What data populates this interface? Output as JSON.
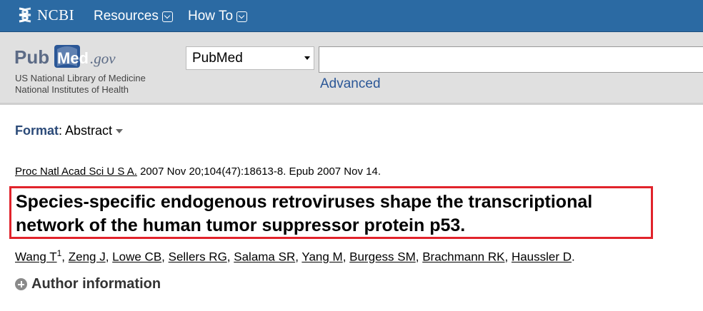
{
  "header": {
    "logo_text": "NCBI",
    "nav": [
      {
        "label": "Resources"
      },
      {
        "label": "How To"
      }
    ]
  },
  "search": {
    "logo": {
      "pub": "Pub",
      "med": "Med",
      "gov": ".gov"
    },
    "subtitle_line1": "US National Library of Medicine",
    "subtitle_line2": "National Institutes of Health",
    "database": "PubMed",
    "query": "",
    "advanced_label": "Advanced"
  },
  "format": {
    "label": "Format",
    "value": "Abstract"
  },
  "article": {
    "journal": "Proc Natl Acad Sci U S A.",
    "citation": " 2007 Nov 20;104(47):18613-8. Epub 2007 Nov 14.",
    "title": "Species-specific endogenous retroviruses shape the transcriptional network of the human tumor suppressor protein p53.",
    "authors": [
      {
        "name": "Wang T",
        "sup": "1"
      },
      {
        "name": "Zeng J"
      },
      {
        "name": "Lowe CB"
      },
      {
        "name": "Sellers RG"
      },
      {
        "name": "Salama SR"
      },
      {
        "name": "Yang M"
      },
      {
        "name": "Burgess SM"
      },
      {
        "name": "Brachmann RK"
      },
      {
        "name": "Haussler D"
      }
    ],
    "author_info_label": "Author information"
  },
  "colors": {
    "header_bg": "#2b6aa3",
    "highlight_box": "#e1232b",
    "link": "#2b5797"
  }
}
